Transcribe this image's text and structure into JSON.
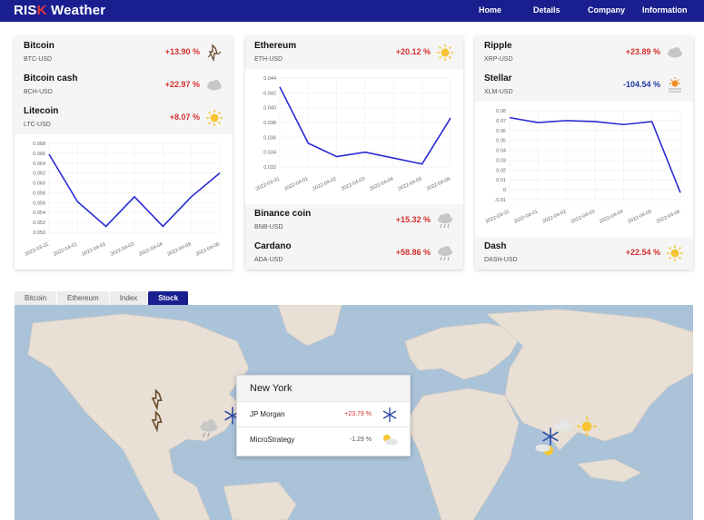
{
  "header": {
    "logo_prefix": "RIS",
    "logo_x": "K",
    "logo_suffix": " Weather",
    "nav": [
      "Home",
      "Details",
      "Company",
      "Information"
    ]
  },
  "colors": {
    "brand": "#1a1f8f",
    "positive": "#d32f2f",
    "negative": "#1e3aa0",
    "line": "#2a2ad6"
  },
  "cards": [
    {
      "rows_top": [
        {
          "name": "Bitcoin",
          "pair": "BTC-USD",
          "pct": "+13.90 %",
          "icon": "storm-icon"
        },
        {
          "name": "Bitcoin cash",
          "pair": "BCH-USD",
          "pct": "+22.97 %",
          "icon": "cloud-icon"
        },
        {
          "name": "Litecoin",
          "pair": "LTC-USD",
          "pct": "+8.07 %",
          "icon": "sun-icon"
        }
      ],
      "rows_bottom": []
    },
    {
      "rows_top": [
        {
          "name": "Ethereum",
          "pair": "ETH-USD",
          "pct": "+20.12 %",
          "icon": "sun-icon"
        }
      ],
      "rows_bottom": [
        {
          "name": "Binance coin",
          "pair": "BNB-USD",
          "pct": "+15.32 %",
          "icon": "rain-cloud-icon"
        },
        {
          "name": "Cardano",
          "pair": "ADA-USD",
          "pct": "+58.86 %",
          "icon": "rain-cloud-icon"
        }
      ]
    },
    {
      "rows_top": [
        {
          "name": "Ripple",
          "pair": "XRP-USD",
          "pct": "+23.89 %",
          "icon": "cloud-icon"
        },
        {
          "name": "Stellar",
          "pair": "XLM-USD",
          "pct": "-104.54 %",
          "icon": "sun-fog-icon"
        }
      ],
      "rows_bottom": [
        {
          "name": "Dash",
          "pair": "DASH-USD",
          "pct": "+22.54 %",
          "icon": "sun-icon"
        }
      ]
    }
  ],
  "chart_data": [
    {
      "type": "line",
      "x": [
        "2022-03-31",
        "2022-04-01",
        "2022-04-02",
        "2022-04-03",
        "2022-04-04",
        "2022-04-05",
        "2022-04-06"
      ],
      "y": [
        0.0658,
        0.0562,
        0.0512,
        0.0572,
        0.0512,
        0.0572,
        0.062
      ],
      "yticks": [
        "0.068",
        "0.066",
        "0.064",
        "0.062",
        "0.060",
        "0.058",
        "0.056",
        "0.054",
        "0.052",
        "0.050"
      ],
      "ylim": [
        0.05,
        0.068
      ]
    },
    {
      "type": "line",
      "x": [
        "2022-03-31",
        "2022-04-01",
        "2022-04-02",
        "2022-04-03",
        "2022-04-04",
        "2022-04-05",
        "2022-04-06"
      ],
      "y": [
        0.0428,
        0.0352,
        0.0334,
        0.034,
        0.0332,
        0.0324,
        0.0386
      ],
      "yticks": [
        "0.044",
        "0.042",
        "0.040",
        "0.038",
        "0.036",
        "0.034",
        "0.032"
      ],
      "ylim": [
        0.032,
        0.044
      ]
    },
    {
      "type": "line",
      "x": [
        "2022-03-31",
        "2022-04-01",
        "2022-04-02",
        "2022-04-03",
        "2022-04-04",
        "2022-04-05",
        "2022-04-06"
      ],
      "y": [
        0.073,
        0.068,
        0.07,
        0.069,
        0.066,
        0.069,
        -0.003
      ],
      "yticks": [
        "0.08",
        "0.07",
        "0.06",
        "0.05",
        "0.04",
        "0.03",
        "0.02",
        "0.01",
        "0",
        "-0.01"
      ],
      "ylim": [
        -0.01,
        0.08
      ]
    }
  ],
  "tabs": [
    "Bitcoin",
    "Ethereum",
    "Index",
    "Stock"
  ],
  "active_tab": "Stock",
  "popup": {
    "title": "New York",
    "rows": [
      {
        "name": "JP Morgan",
        "pct": "+23.79 %",
        "icon": "snowflake-icon"
      },
      {
        "name": "MicroStrategy",
        "pct": "-1.29 %",
        "icon": "sun-cloud-icon"
      }
    ]
  }
}
